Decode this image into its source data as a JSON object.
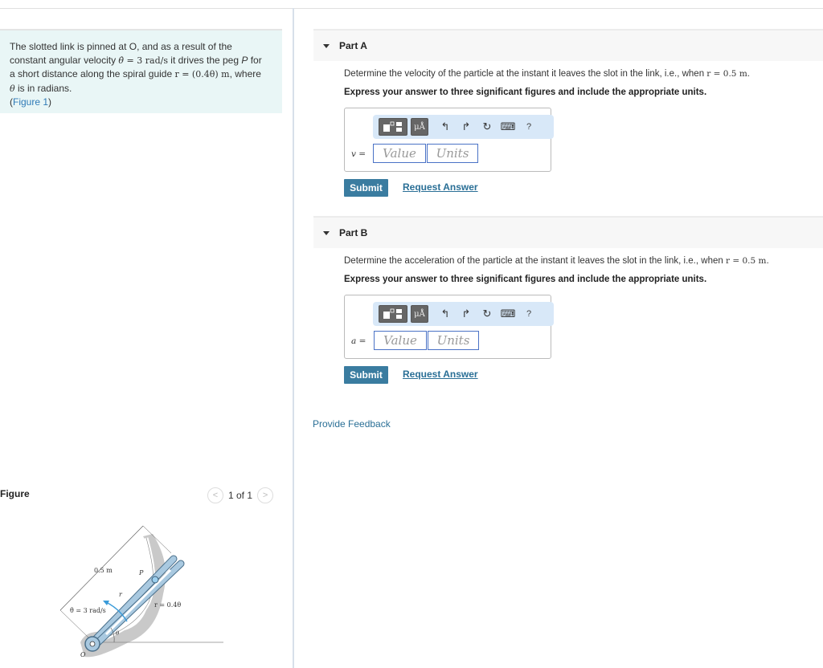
{
  "problem": {
    "line1": "The slotted link is pinned at O, and as a result of the",
    "line2a": "constant angular velocity ",
    "theta_dot": "θ̇",
    "eq1": " = 3 rad/s",
    "line2b": " it drives the peg ",
    "peg": "P",
    "line2c": " for",
    "line3a": "a short distance along the spiral guide ",
    "eq2": "r = (0.4θ)  m",
    "line3b": ", where",
    "theta": "θ",
    "line4": " is in radians.",
    "figure_link_open": "(",
    "figure_link": "Figure 1",
    "figure_link_close": ")"
  },
  "figure": {
    "header": "Figure",
    "pager_text": "1 of 1",
    "prev": "<",
    "next": ">",
    "labels": {
      "length": "0.5 m",
      "peg": "P",
      "r": "r",
      "omega": "θ̇ = 3 rad/s",
      "spiral": "r = 0.4θ",
      "theta": "θ",
      "origin": "O"
    }
  },
  "parts": [
    {
      "title": "Part A",
      "question": "Determine the velocity of the particle at the instant it leaves the slot in the link, i.e., when ",
      "condition": "r = 0.5 m.",
      "instruction": "Express your answer to three significant figures and include the appropriate units.",
      "variable": "v =",
      "value_placeholder": "Value",
      "units_placeholder": "Units",
      "submit": "Submit",
      "request": "Request Answer"
    },
    {
      "title": "Part B",
      "question": "Determine the acceleration of the particle at the instant it leaves the slot in the link, i.e., when ",
      "condition": "r = 0.5 m.",
      "instruction": "Express your answer to three significant figures and include the appropriate units.",
      "variable": "a =",
      "value_placeholder": "Value",
      "units_placeholder": "Units",
      "submit": "Submit",
      "request": "Request Answer"
    }
  ],
  "toolbar": {
    "mu": "μÅ",
    "undo": "↰",
    "redo": "↱",
    "reset": "↻",
    "keyboard": "⌨",
    "help": "?"
  },
  "feedback": "Provide Feedback"
}
